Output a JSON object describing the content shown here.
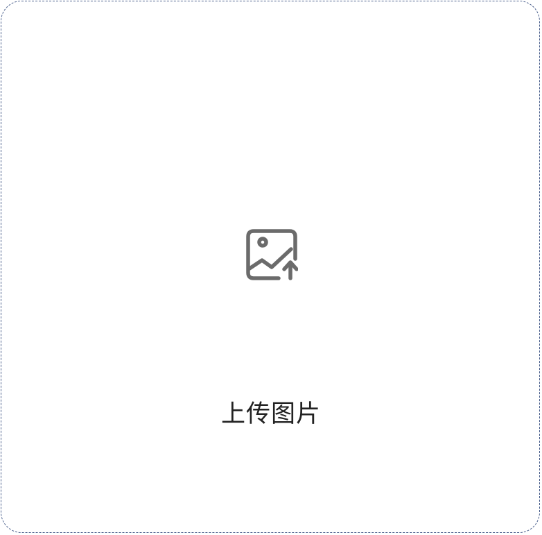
{
  "upload": {
    "label": "上传图片",
    "icon": "image-upload-icon",
    "border_color": "#4a5f8c",
    "icon_color": "#6b6b6b"
  }
}
